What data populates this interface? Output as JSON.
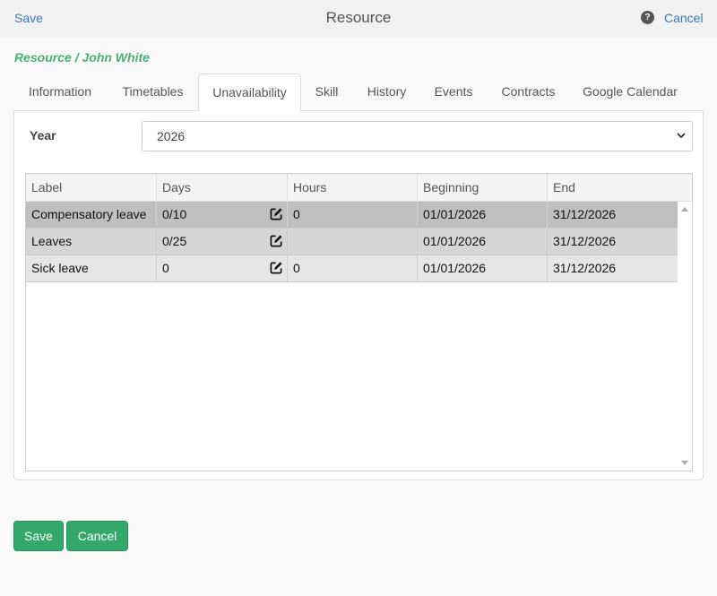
{
  "header": {
    "save_label": "Save",
    "title": "Resource",
    "help_icon": "question-circle-icon",
    "cancel_label": "Cancel"
  },
  "breadcrumb": "Resource / John White",
  "tabs": [
    {
      "label": "Information"
    },
    {
      "label": "Timetables"
    },
    {
      "label": "Unavailability",
      "active": true
    },
    {
      "label": "Skill"
    },
    {
      "label": "History"
    },
    {
      "label": "Events"
    },
    {
      "label": "Contracts"
    },
    {
      "label": "Google Calendar"
    }
  ],
  "year": {
    "label": "Year",
    "value": "2026"
  },
  "grid": {
    "columns": [
      "Label",
      "Days",
      "Hours",
      "Beginning",
      "End"
    ],
    "rows": [
      {
        "label": "Compensatory leave",
        "days": "0/10",
        "hours": "0",
        "beginning": "01/01/2026",
        "end": "31/12/2026"
      },
      {
        "label": "Leaves",
        "days": "0/25",
        "hours": "",
        "beginning": "01/01/2026",
        "end": "31/12/2026"
      },
      {
        "label": "Sick leave",
        "days": "0",
        "hours": "0",
        "beginning": "01/01/2026",
        "end": "31/12/2026"
      }
    ]
  },
  "footer": {
    "save_label": "Save",
    "cancel_label": "Cancel"
  },
  "colors": {
    "accent_green": "#32a86b",
    "link_blue": "#3d7ab8",
    "breadcrumb_green": "#4caf7a"
  }
}
